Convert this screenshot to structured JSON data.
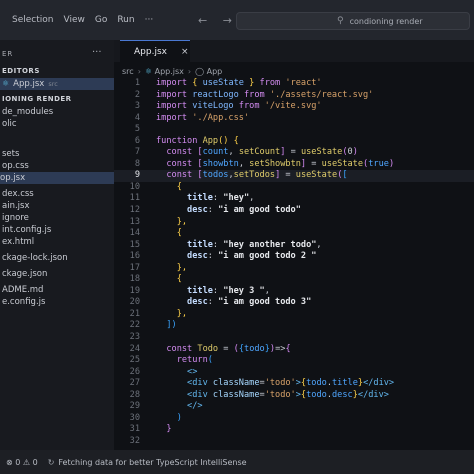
{
  "menu": [
    "Selection",
    "View",
    "Go",
    "Run",
    "···"
  ],
  "nav_arrows": "← →",
  "command_center": {
    "icon": "search-icon",
    "text": "condioning render"
  },
  "sidebar": {
    "header": "ER",
    "more": "···",
    "open_editors_label": "EDITORS",
    "open_editor": {
      "name": "App.jsx",
      "folder": "src"
    },
    "project_label": "IONING RENDER",
    "files": [
      "de_modules",
      "olic",
      "sets",
      "op.css",
      "op.jsx",
      "dex.css",
      "ain.jsx",
      "ignore",
      "int.config.js",
      "ex.html",
      "ckage-lock.json",
      "ckage.json",
      "ADME.md",
      "e.config.js"
    ]
  },
  "tab": {
    "label": "App.jsx",
    "close": "×"
  },
  "breadcrumb": [
    "src",
    "App.jsx",
    "App"
  ],
  "status_bar": {
    "errors": "⊗ 0 ⚠ 0",
    "message": "Fetching data for better TypeScript IntelliSense"
  },
  "code": {
    "lines": [
      [
        [
          "kw",
          "import "
        ],
        [
          "br1",
          "{ "
        ],
        [
          "var",
          "useState"
        ],
        [
          "br1",
          " }"
        ],
        [
          "kw",
          " from "
        ],
        [
          "str",
          "'react'"
        ]
      ],
      [
        [
          "kw",
          "import "
        ],
        [
          "var",
          "reactLogo"
        ],
        [
          "kw",
          " from "
        ],
        [
          "str",
          "'./assets/react.svg'"
        ]
      ],
      [
        [
          "kw",
          "import "
        ],
        [
          "var",
          "viteLogo"
        ],
        [
          "kw",
          " from "
        ],
        [
          "str",
          "'/vite.svg'"
        ]
      ],
      [
        [
          "kw",
          "import "
        ],
        [
          "str",
          "'./App.css'"
        ]
      ],
      [],
      [
        [
          "kw",
          "function "
        ],
        [
          "fn",
          "App"
        ],
        [
          "br1",
          "() {"
        ]
      ],
      [
        [
          "pun",
          "  "
        ],
        [
          "kw",
          "const "
        ],
        [
          "br2",
          "["
        ],
        [
          "cst",
          "count"
        ],
        [
          "pun",
          ", "
        ],
        [
          "fn",
          "setCount"
        ],
        [
          "br2",
          "]"
        ],
        [
          "pun",
          " = "
        ],
        [
          "fn",
          "useState"
        ],
        [
          "br2",
          "("
        ],
        [
          "pun",
          "0"
        ],
        [
          "br2",
          ")"
        ]
      ],
      [
        [
          "pun",
          "  "
        ],
        [
          "kw",
          "const "
        ],
        [
          "br2",
          "["
        ],
        [
          "cst",
          "showbtn"
        ],
        [
          "pun",
          ", "
        ],
        [
          "fn",
          "setShowbtn"
        ],
        [
          "br2",
          "]"
        ],
        [
          "pun",
          " = "
        ],
        [
          "fn",
          "useState"
        ],
        [
          "br2",
          "("
        ],
        [
          "cst",
          "true"
        ],
        [
          "br2",
          ")"
        ]
      ],
      [
        [
          "pun",
          "  "
        ],
        [
          "kw",
          "const "
        ],
        [
          "br2",
          "["
        ],
        [
          "cst",
          "todos"
        ],
        [
          "pun",
          ","
        ],
        [
          "fn",
          "setTodos"
        ],
        [
          "br2",
          "]"
        ],
        [
          "pun",
          " = "
        ],
        [
          "fn",
          "useState"
        ],
        [
          "br2",
          "("
        ],
        [
          "br3",
          "["
        ]
      ],
      [
        [
          "pun",
          "    "
        ],
        [
          "br1",
          "{"
        ]
      ],
      [
        [
          "pun",
          "      "
        ],
        [
          "prop",
          "title"
        ],
        [
          "pun",
          ": "
        ],
        [
          "white",
          "\"hey\""
        ],
        [
          "pun",
          ","
        ]
      ],
      [
        [
          "pun",
          "      "
        ],
        [
          "prop",
          "desc"
        ],
        [
          "pun",
          ": "
        ],
        [
          "white",
          "\"i am good todo\""
        ]
      ],
      [
        [
          "pun",
          "    "
        ],
        [
          "br1",
          "},"
        ]
      ],
      [
        [
          "pun",
          "    "
        ],
        [
          "br1",
          "{"
        ]
      ],
      [
        [
          "pun",
          "      "
        ],
        [
          "prop",
          "title"
        ],
        [
          "pun",
          ": "
        ],
        [
          "white",
          "\"hey another todo\""
        ],
        [
          "pun",
          ","
        ]
      ],
      [
        [
          "pun",
          "      "
        ],
        [
          "prop",
          "desc"
        ],
        [
          "pun",
          ": "
        ],
        [
          "white",
          "\"i am good todo 2 \""
        ]
      ],
      [
        [
          "pun",
          "    "
        ],
        [
          "br1",
          "},"
        ]
      ],
      [
        [
          "pun",
          "    "
        ],
        [
          "br1",
          "{"
        ]
      ],
      [
        [
          "pun",
          "      "
        ],
        [
          "prop",
          "title"
        ],
        [
          "pun",
          ": "
        ],
        [
          "white",
          "\"hey 3 \""
        ],
        [
          "pun",
          ","
        ]
      ],
      [
        [
          "pun",
          "      "
        ],
        [
          "prop",
          "desc"
        ],
        [
          "pun",
          ": "
        ],
        [
          "white",
          "\"i am good todo 3\""
        ]
      ],
      [
        [
          "pun",
          "    "
        ],
        [
          "br1",
          "},"
        ]
      ],
      [
        [
          "pun",
          "  "
        ],
        [
          "br3",
          "])"
        ]
      ],
      [],
      [
        [
          "pun",
          "  "
        ],
        [
          "kw",
          "const "
        ],
        [
          "fn",
          "Todo"
        ],
        [
          "pun",
          " = "
        ],
        [
          "br2",
          "("
        ],
        [
          "br3",
          "{"
        ],
        [
          "cst",
          "todo"
        ],
        [
          "br3",
          "}"
        ],
        [
          "br2",
          ")"
        ],
        [
          "pun",
          "=>"
        ],
        [
          "br2",
          "{"
        ]
      ],
      [
        [
          "pun",
          "    "
        ],
        [
          "kw",
          "return"
        ],
        [
          "br3",
          "("
        ]
      ],
      [
        [
          "pun",
          "      "
        ],
        [
          "tag",
          "<>"
        ]
      ],
      [
        [
          "pun",
          "      "
        ],
        [
          "tag",
          "<div "
        ],
        [
          "attr",
          "className"
        ],
        [
          "pun",
          "="
        ],
        [
          "str",
          "'todo'"
        ],
        [
          "tag",
          ">"
        ],
        [
          "br1",
          "{"
        ],
        [
          "cst",
          "todo"
        ],
        [
          "pun",
          "."
        ],
        [
          "cst",
          "title"
        ],
        [
          "br1",
          "}"
        ],
        [
          "tag",
          "</div>"
        ]
      ],
      [
        [
          "pun",
          "      "
        ],
        [
          "tag",
          "<div "
        ],
        [
          "attr",
          "className"
        ],
        [
          "pun",
          "="
        ],
        [
          "str",
          "'todo'"
        ],
        [
          "tag",
          ">"
        ],
        [
          "br1",
          "{"
        ],
        [
          "cst",
          "todo"
        ],
        [
          "pun",
          "."
        ],
        [
          "cst",
          "desc"
        ],
        [
          "br1",
          "}"
        ],
        [
          "tag",
          "</div>"
        ]
      ],
      [
        [
          "pun",
          "      "
        ],
        [
          "tag",
          "</>"
        ]
      ],
      [
        [
          "pun",
          "    "
        ],
        [
          "br3",
          ")"
        ]
      ],
      [
        [
          "pun",
          "  "
        ],
        [
          "br2",
          "}"
        ]
      ],
      []
    ]
  }
}
